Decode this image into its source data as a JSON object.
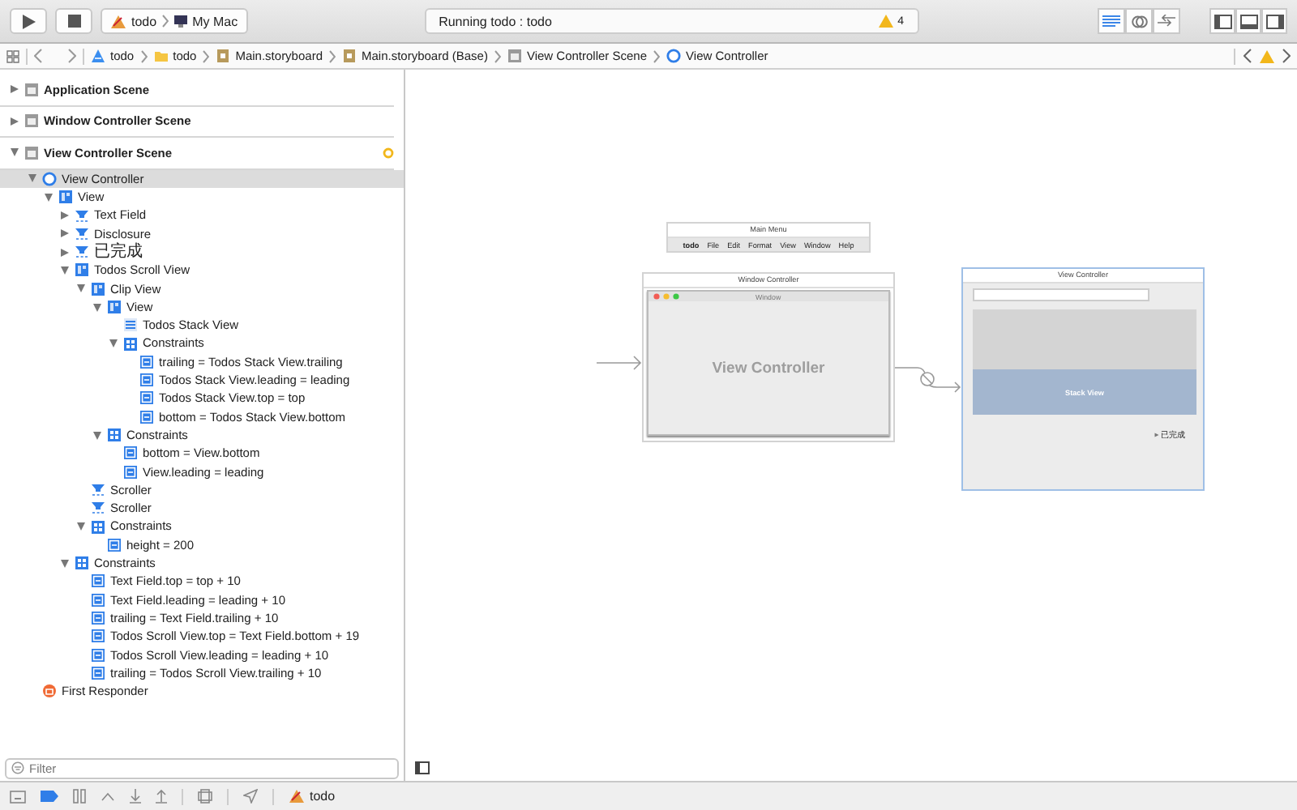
{
  "toolbar": {
    "scheme": "todo",
    "destination": "My Mac",
    "status": "Running todo : todo",
    "warning_count": "4"
  },
  "jump_bar": [
    {
      "label": "todo",
      "kind": "project"
    },
    {
      "label": "todo",
      "kind": "folder"
    },
    {
      "label": "Main.storyboard",
      "kind": "storyboard"
    },
    {
      "label": "Main.storyboard (Base)",
      "kind": "storyboard"
    },
    {
      "label": "View Controller Scene",
      "kind": "scene"
    },
    {
      "label": "View Controller",
      "kind": "controller"
    }
  ],
  "outline": [
    {
      "label": "Application Scene",
      "kind": "scene",
      "expanded": false,
      "selected": false,
      "warning": false
    },
    {
      "label": "Window Controller Scene",
      "kind": "scene",
      "expanded": false,
      "selected": false,
      "warning": false
    },
    {
      "label": "View Controller Scene",
      "kind": "scene",
      "expanded": true,
      "selected": false,
      "warning": true,
      "children": [
        {
          "label": "View Controller",
          "kind": "controller",
          "expanded": true,
          "selected": true,
          "children": [
            {
              "label": "View",
              "kind": "view",
              "expanded": true,
              "selected": false,
              "children": [
                {
                  "label": "Text Field",
                  "kind": "control",
                  "expanded": false,
                  "selected": false
                },
                {
                  "label": "Disclosure",
                  "kind": "control",
                  "expanded": false,
                  "selected": false
                },
                {
                  "label": "已完成",
                  "kind": "control",
                  "expanded": false,
                  "selected": false
                },
                {
                  "label": "Todos Scroll View",
                  "kind": "view",
                  "expanded": true,
                  "selected": false,
                  "children": [
                    {
                      "label": "Clip View",
                      "kind": "view",
                      "expanded": true,
                      "selected": false,
                      "children": [
                        {
                          "label": "View",
                          "kind": "view",
                          "expanded": true,
                          "selected": false,
                          "children": [
                            {
                              "label": "Todos Stack View",
                              "kind": "stack",
                              "selected": false
                            },
                            {
                              "label": "Constraints",
                              "kind": "constraints",
                              "expanded": true,
                              "selected": false,
                              "children": [
                                {
                                  "label": "trailing = Todos Stack View.trailing",
                                  "kind": "constraint",
                                  "selected": false
                                },
                                {
                                  "label": "Todos Stack View.leading = leading",
                                  "kind": "constraint",
                                  "selected": false
                                },
                                {
                                  "label": "Todos Stack View.top = top",
                                  "kind": "constraint",
                                  "selected": false
                                },
                                {
                                  "label": "bottom = Todos Stack View.bottom",
                                  "kind": "constraint",
                                  "selected": false
                                }
                              ]
                            }
                          ]
                        },
                        {
                          "label": "Constraints",
                          "kind": "constraints",
                          "expanded": true,
                          "selected": false,
                          "children": [
                            {
                              "label": "bottom = View.bottom",
                              "kind": "constraint",
                              "selected": false
                            },
                            {
                              "label": "View.leading = leading",
                              "kind": "constraint",
                              "selected": false
                            }
                          ]
                        }
                      ]
                    },
                    {
                      "label": "Scroller",
                      "kind": "control",
                      "selected": false
                    },
                    {
                      "label": "Scroller",
                      "kind": "control",
                      "selected": false
                    },
                    {
                      "label": "Constraints",
                      "kind": "constraints",
                      "expanded": true,
                      "selected": false,
                      "children": [
                        {
                          "label": "height = 200",
                          "kind": "constraint",
                          "selected": false
                        }
                      ]
                    }
                  ]
                },
                {
                  "label": "Constraints",
                  "kind": "constraints",
                  "expanded": true,
                  "selected": false,
                  "children": [
                    {
                      "label": "Text Field.top = top + 10",
                      "kind": "constraint",
                      "selected": false
                    },
                    {
                      "label": "Text Field.leading = leading + 10",
                      "kind": "constraint",
                      "selected": false
                    },
                    {
                      "label": "trailing = Text Field.trailing + 10",
                      "kind": "constraint",
                      "selected": false
                    },
                    {
                      "label": "Todos Scroll View.top = Text Field.bottom + 19",
                      "kind": "constraint",
                      "selected": false
                    },
                    {
                      "label": "Todos Scroll View.leading = leading + 10",
                      "kind": "constraint",
                      "selected": false
                    },
                    {
                      "label": "trailing = Todos Scroll View.trailing + 10",
                      "kind": "constraint",
                      "selected": false
                    }
                  ]
                }
              ]
            }
          ]
        },
        {
          "label": "First Responder",
          "kind": "responder",
          "selected": false
        }
      ]
    }
  ],
  "filter": {
    "placeholder": "Filter"
  },
  "canvas": {
    "main_menu": {
      "title": "Main Menu",
      "items": [
        "todo",
        "File",
        "Edit",
        "Format",
        "View",
        "Window",
        "Help"
      ]
    },
    "window_controller": {
      "title": "Window Controller",
      "window_title": "Window",
      "content": "View Controller"
    },
    "view_controller": {
      "title": "View Controller",
      "stack_label": "Stack View",
      "disclosure_label": "已完成"
    }
  },
  "debug_bar": {
    "target": "todo"
  }
}
